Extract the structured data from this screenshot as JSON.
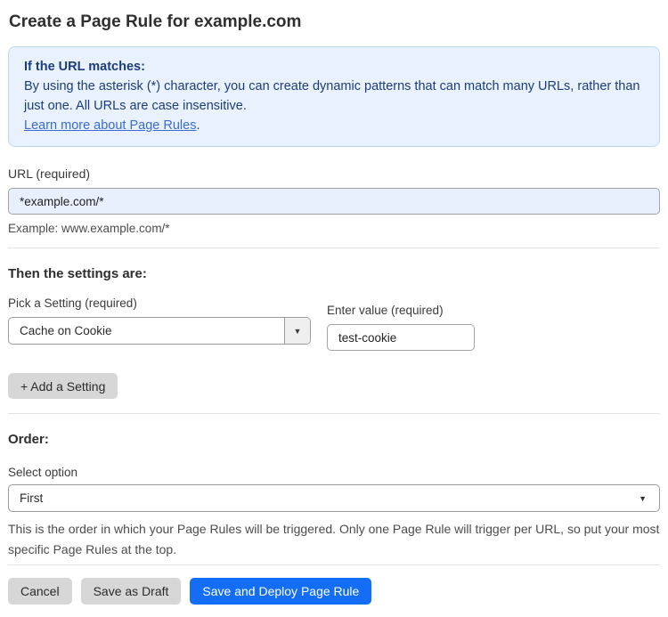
{
  "page": {
    "title": "Create a Page Rule for example.com"
  },
  "info_box": {
    "heading": "If the URL matches:",
    "body": "By using the asterisk (*) character, you can create dynamic patterns that can match many URLs, rather than just one. All URLs are case insensitive.",
    "link_text": "Learn more about Page Rules",
    "link_suffix": "."
  },
  "url_field": {
    "label": "URL (required)",
    "value": "*example.com/*",
    "helper": "Example: www.example.com/*"
  },
  "settings_section": {
    "heading": "Then the settings are:",
    "setting_select": {
      "label": "Pick a Setting (required)",
      "value": "Cache on Cookie"
    },
    "value_field": {
      "label": "Enter value (required)",
      "value": "test-cookie"
    },
    "add_setting_label": "+ Add a Setting"
  },
  "order_section": {
    "heading": "Order:",
    "select_label": "Select option",
    "select_value": "First",
    "helper": "This is the order in which your Page Rules will be triggered. Only one Page Rule will trigger per URL, so put your most specific Page Rules at the top."
  },
  "actions": {
    "cancel_label": "Cancel",
    "save_draft_label": "Save as Draft",
    "save_deploy_label": "Save and Deploy Page Rule"
  },
  "icons": {
    "caret_down": "▼"
  },
  "colors": {
    "info_box_bg": "#e9f2fc",
    "info_box_border": "#bcd9f4",
    "info_text": "#1c3d7c",
    "link_blue": "#3a6bd3",
    "autofill_input_bg": "#e8f0fe",
    "primary_button_blue": "#146ef5",
    "secondary_button_gray": "#d7d7d7"
  }
}
